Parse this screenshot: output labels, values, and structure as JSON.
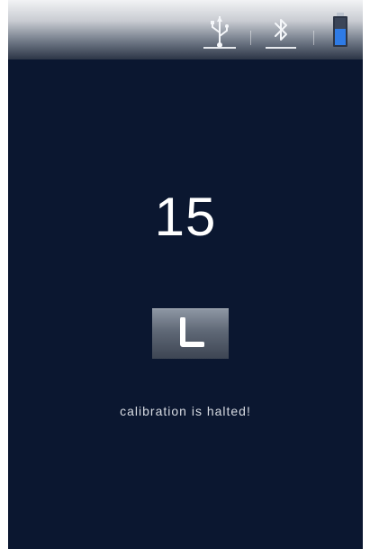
{
  "status_bar": {
    "icons": [
      "usb-icon",
      "bluetooth-icon",
      "battery-icon"
    ],
    "colors": {
      "gradient_top": "#f2f3f5",
      "gradient_bottom": "#2c3546",
      "battery_fill": "#2e7be6"
    }
  },
  "main": {
    "count": "15",
    "pose_button_icon": "l-shape-pose-icon",
    "status_message": "calibration is halted!"
  },
  "colors": {
    "background": "#0b1730",
    "text": "#ffffff",
    "muted_text": "#d7dbe2"
  }
}
